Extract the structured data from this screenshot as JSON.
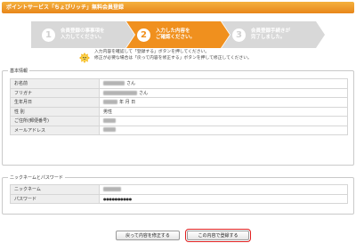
{
  "header": {
    "title": "ポイントサービス「ちょびリッチ」無料会員登録"
  },
  "steps": [
    {
      "num": "1",
      "text_line1": "会員登録の事事項を",
      "text_line2": "入力してください。",
      "active": false
    },
    {
      "num": "2",
      "text_line1": "入力した内容を",
      "text_line2": "ご確認ください。",
      "active": true
    },
    {
      "num": "3",
      "text_line1": "会員登録手続きが",
      "text_line2": "完了しました。",
      "active": false
    }
  ],
  "notice": {
    "line1": "入力内容を確認して「登録する」ボタンを押してください。",
    "line2": "修正が必要な場合は「戻って内容を修正する」ボタンを押して修正してください。"
  },
  "basic_info": {
    "legend": "基本情報",
    "rows": [
      {
        "label": "お名前",
        "suffix": "さん"
      },
      {
        "label": "フリガナ",
        "suffix": "さん"
      },
      {
        "label": "生年月日",
        "suffix": "年 月 日"
      },
      {
        "label": "性 別",
        "value": "男性"
      },
      {
        "label": "ご住所(郵便番号)",
        "suffix": ""
      },
      {
        "label": "メールアドレス",
        "suffix": ""
      }
    ]
  },
  "nickname_section": {
    "legend": "ニックネームとパスワード",
    "rows": [
      {
        "label": "ニックネーム",
        "value": ""
      },
      {
        "label": "パスワード",
        "value": "●●●●●●●●●●"
      }
    ]
  },
  "buttons": {
    "back_label": "戻って内容を修正する",
    "submit_label": "この内容で登録する"
  },
  "colors": {
    "accent": "#f0901e",
    "inactive_step": "#d8d8d8",
    "highlight": "#e02020"
  }
}
